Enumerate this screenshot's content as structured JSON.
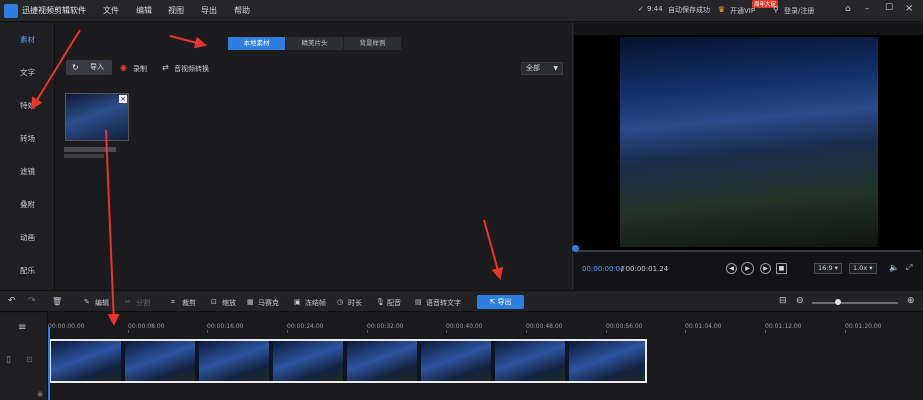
{
  "title_bar": {
    "app_title": "迅捷视频剪辑软件",
    "menus": [
      "文件",
      "编辑",
      "视图",
      "导出",
      "帮助"
    ],
    "autosave_time": "9:44",
    "autosave_text": "自动保存成功",
    "vip_label": "开通VIP",
    "vip_badge": "周年大促",
    "login_label": "登录/注册"
  },
  "left_nav": {
    "items": [
      "素材",
      "文字",
      "特效",
      "转场",
      "滤镜",
      "叠附",
      "动画",
      "配乐"
    ],
    "active_index": 0
  },
  "media_panel": {
    "tabs": [
      "本地素材",
      "精美片头",
      "背景样例"
    ],
    "active_tab": 0,
    "import_label": "导入",
    "record_label": "录制",
    "convert_label": "音视频转换",
    "filter_value": "全部"
  },
  "preview": {
    "current_time": "00:00:00.00",
    "total_time": "/ 00:00:01.24",
    "aspect_ratio": "16:9",
    "speed": "1.0x"
  },
  "timeline_toolbar": {
    "tools": [
      "编辑",
      "分割",
      "裁剪",
      "缩放",
      "马赛克",
      "冻结帧",
      "时长",
      "配音",
      "语音转文字"
    ],
    "disabled_tools": [
      "分割"
    ],
    "export_label": "导出"
  },
  "timeline": {
    "ruler_labels": [
      "00:00:00.00",
      "00:00:08.00",
      "00:00:16.00",
      "00:00:24.00",
      "00:00:32.00",
      "00:00:40.00",
      "00:00:48.00",
      "00:00:56.00",
      "00:01:04.00",
      "00:01:12.00",
      "00:01:20.00"
    ]
  },
  "colors": {
    "accent": "#2f7fe0",
    "annotation_arrow": "#e8362c"
  }
}
